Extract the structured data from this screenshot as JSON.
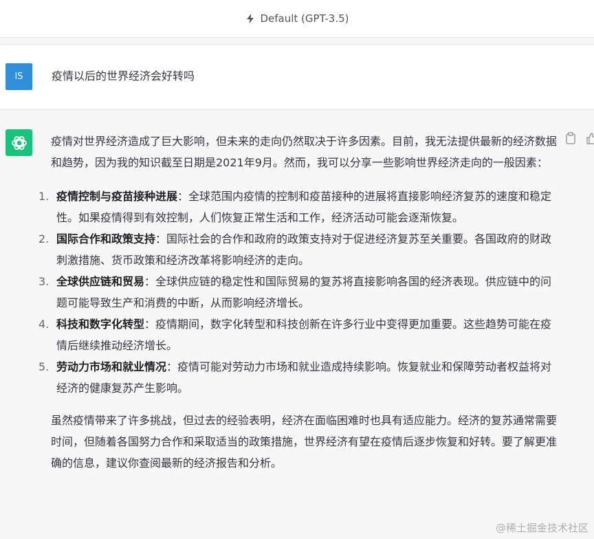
{
  "header": {
    "model_label": "Default (GPT-3.5)"
  },
  "user": {
    "avatar_initials": "IS",
    "message": "疫情以后的世界经济会好转吗"
  },
  "assistant": {
    "intro": "疫情对世界经济造成了巨大影响，但未来的走向仍然取决于许多因素。目前，我无法提供最新的经济数据和趋势，因为我的知识截至日期是2021年9月。然而，我可以分享一些影响世界经济走向的一般因素：",
    "items": [
      {
        "number": "1.",
        "title": "疫情控制与疫苗接种进展",
        "text": "：全球范围内疫情的控制和疫苗接种的进展将直接影响经济复苏的速度和稳定性。如果疫情得到有效控制，人们恢复正常生活和工作，经济活动可能会逐渐恢复。"
      },
      {
        "number": "2.",
        "title": "国际合作和政策支持",
        "text": "：国际社会的合作和政府的政策支持对于促进经济复苏至关重要。各国政府的财政刺激措施、货币政策和经济改革将影响经济的走向。"
      },
      {
        "number": "3.",
        "title": "全球供应链和贸易",
        "text": "：全球供应链的稳定性和国际贸易的复苏将直接影响各国的经济表现。供应链中的问题可能导致生产和消费的中断，从而影响经济增长。"
      },
      {
        "number": "4.",
        "title": "科技和数字化转型",
        "text": "：疫情期间，数字化转型和科技创新在许多行业中变得更加重要。这些趋势可能在疫情后继续推动经济增长。"
      },
      {
        "number": "5.",
        "title": "劳动力市场和就业情况",
        "text": "：疫情可能对劳动力市场和就业造成持续影响。恢复就业和保障劳动者权益将对经济的健康复苏产生影响。"
      }
    ],
    "conclusion": "虽然疫情带来了许多挑战，但过去的经验表明，经济在面临困难时也具有适应能力。经济的复苏通常需要时间，但随着各国努力合作和采取适当的政策措施，世界经济有望在疫情后逐步恢复和好转。要了解更准确的信息，建议你查阅最新的经济报告和分析。"
  },
  "watermark": "@稀土掘金技术社区",
  "colors": {
    "user_avatar": "#2f8fda",
    "gpt_avatar": "#19c37d",
    "assistant_bg": "#f7f7f8"
  },
  "icons": {
    "header": "bolt-icon",
    "gpt_avatar": "openai-logo-icon",
    "copy": "clipboard-icon",
    "feedback": "thumbs-up-icon"
  }
}
